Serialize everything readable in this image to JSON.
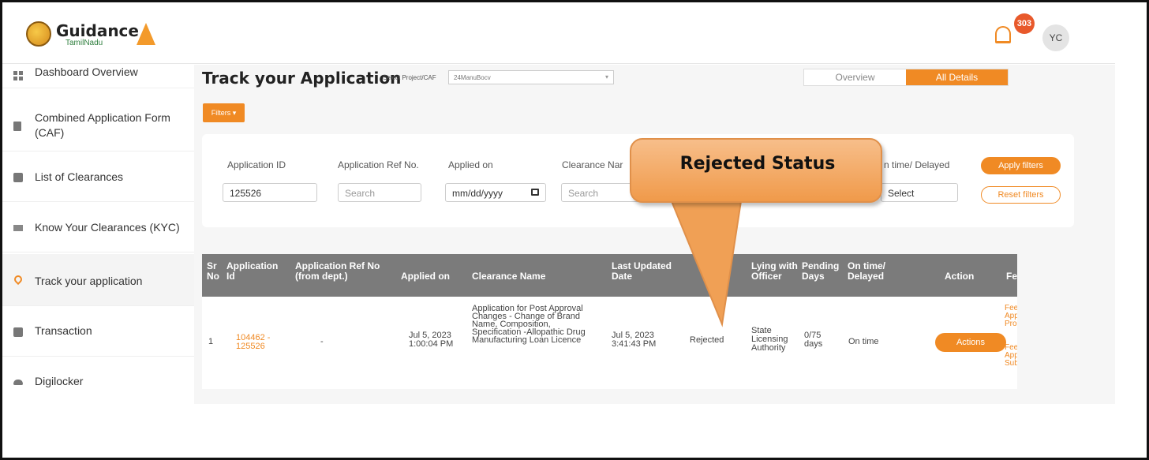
{
  "header": {
    "logo_title": "Guidance",
    "logo_sub": "TamilNadu",
    "notification_count": "303",
    "avatar_initials": "YC"
  },
  "sidebar": {
    "items": [
      {
        "label": "Dashboard Overview",
        "icon": "grid-icon"
      },
      {
        "label": "Combined Application Form (CAF)",
        "icon": "document-icon"
      },
      {
        "label": "List of Clearances",
        "icon": "list-icon"
      },
      {
        "label": "Know Your Clearances (KYC)",
        "icon": "book-icon"
      },
      {
        "label": "Track your application",
        "icon": "location-pin-icon"
      },
      {
        "label": "Transaction",
        "icon": "transaction-icon"
      },
      {
        "label": "Digilocker",
        "icon": "cloud-icon"
      }
    ]
  },
  "main": {
    "title": "Track your Application",
    "project_label": "Select Project/CAF",
    "project_value": "24ManuBocv",
    "tabs": [
      "Overview",
      "All Details"
    ],
    "filters_button": "Filters"
  },
  "filters": {
    "application_id_label": "Application ID",
    "application_id_value": "125526",
    "ref_no_label": "Application Ref No.",
    "ref_no_placeholder": "Search",
    "applied_on_label": "Applied on",
    "applied_on_placeholder": "mm/dd/yyyy",
    "clearance_label": "Clearance Nar",
    "clearance_placeholder": "Search",
    "ontime_label": "n time/ Delayed",
    "ontime_placeholder": "Select",
    "apply_label": "Apply filters",
    "reset_label": "Reset filters"
  },
  "table": {
    "headers": {
      "sr": "Sr No",
      "app_id": "Application Id",
      "ref": "Application Ref No (from dept.)",
      "applied": "Applied on",
      "clearance": "Clearance Name",
      "updated": "Last Updated Date",
      "status": "S",
      "officer": "Lying with Officer",
      "pending": "Pending Days",
      "ontime": "On time/ Delayed",
      "action": "Action",
      "feedback": "Feec"
    },
    "row": {
      "sr": "1",
      "app_id": "104462 - 125526",
      "ref": "-",
      "applied": "Jul 5, 2023 1:00:04 PM",
      "clearance": "Application for Post Approval Changes - Change of Brand Name, Composition, Specification -Allopathic Drug Manufacturing Loan Licence",
      "updated": "Jul 5, 2023 3:41:43 PM",
      "status": "Rejected",
      "officer": "State Licensing Authority",
      "pending": "0/75 days",
      "ontime": "On time",
      "action": "Actions",
      "feedback_1": "Feed Appli Proce",
      "feedback_2": "Feed Appli Subn"
    }
  },
  "callout": {
    "text": "Rejected Status"
  },
  "colors": {
    "accent": "#f08a24",
    "table_header": "#7b7b7b",
    "callout_fill": "#f3a55e"
  }
}
